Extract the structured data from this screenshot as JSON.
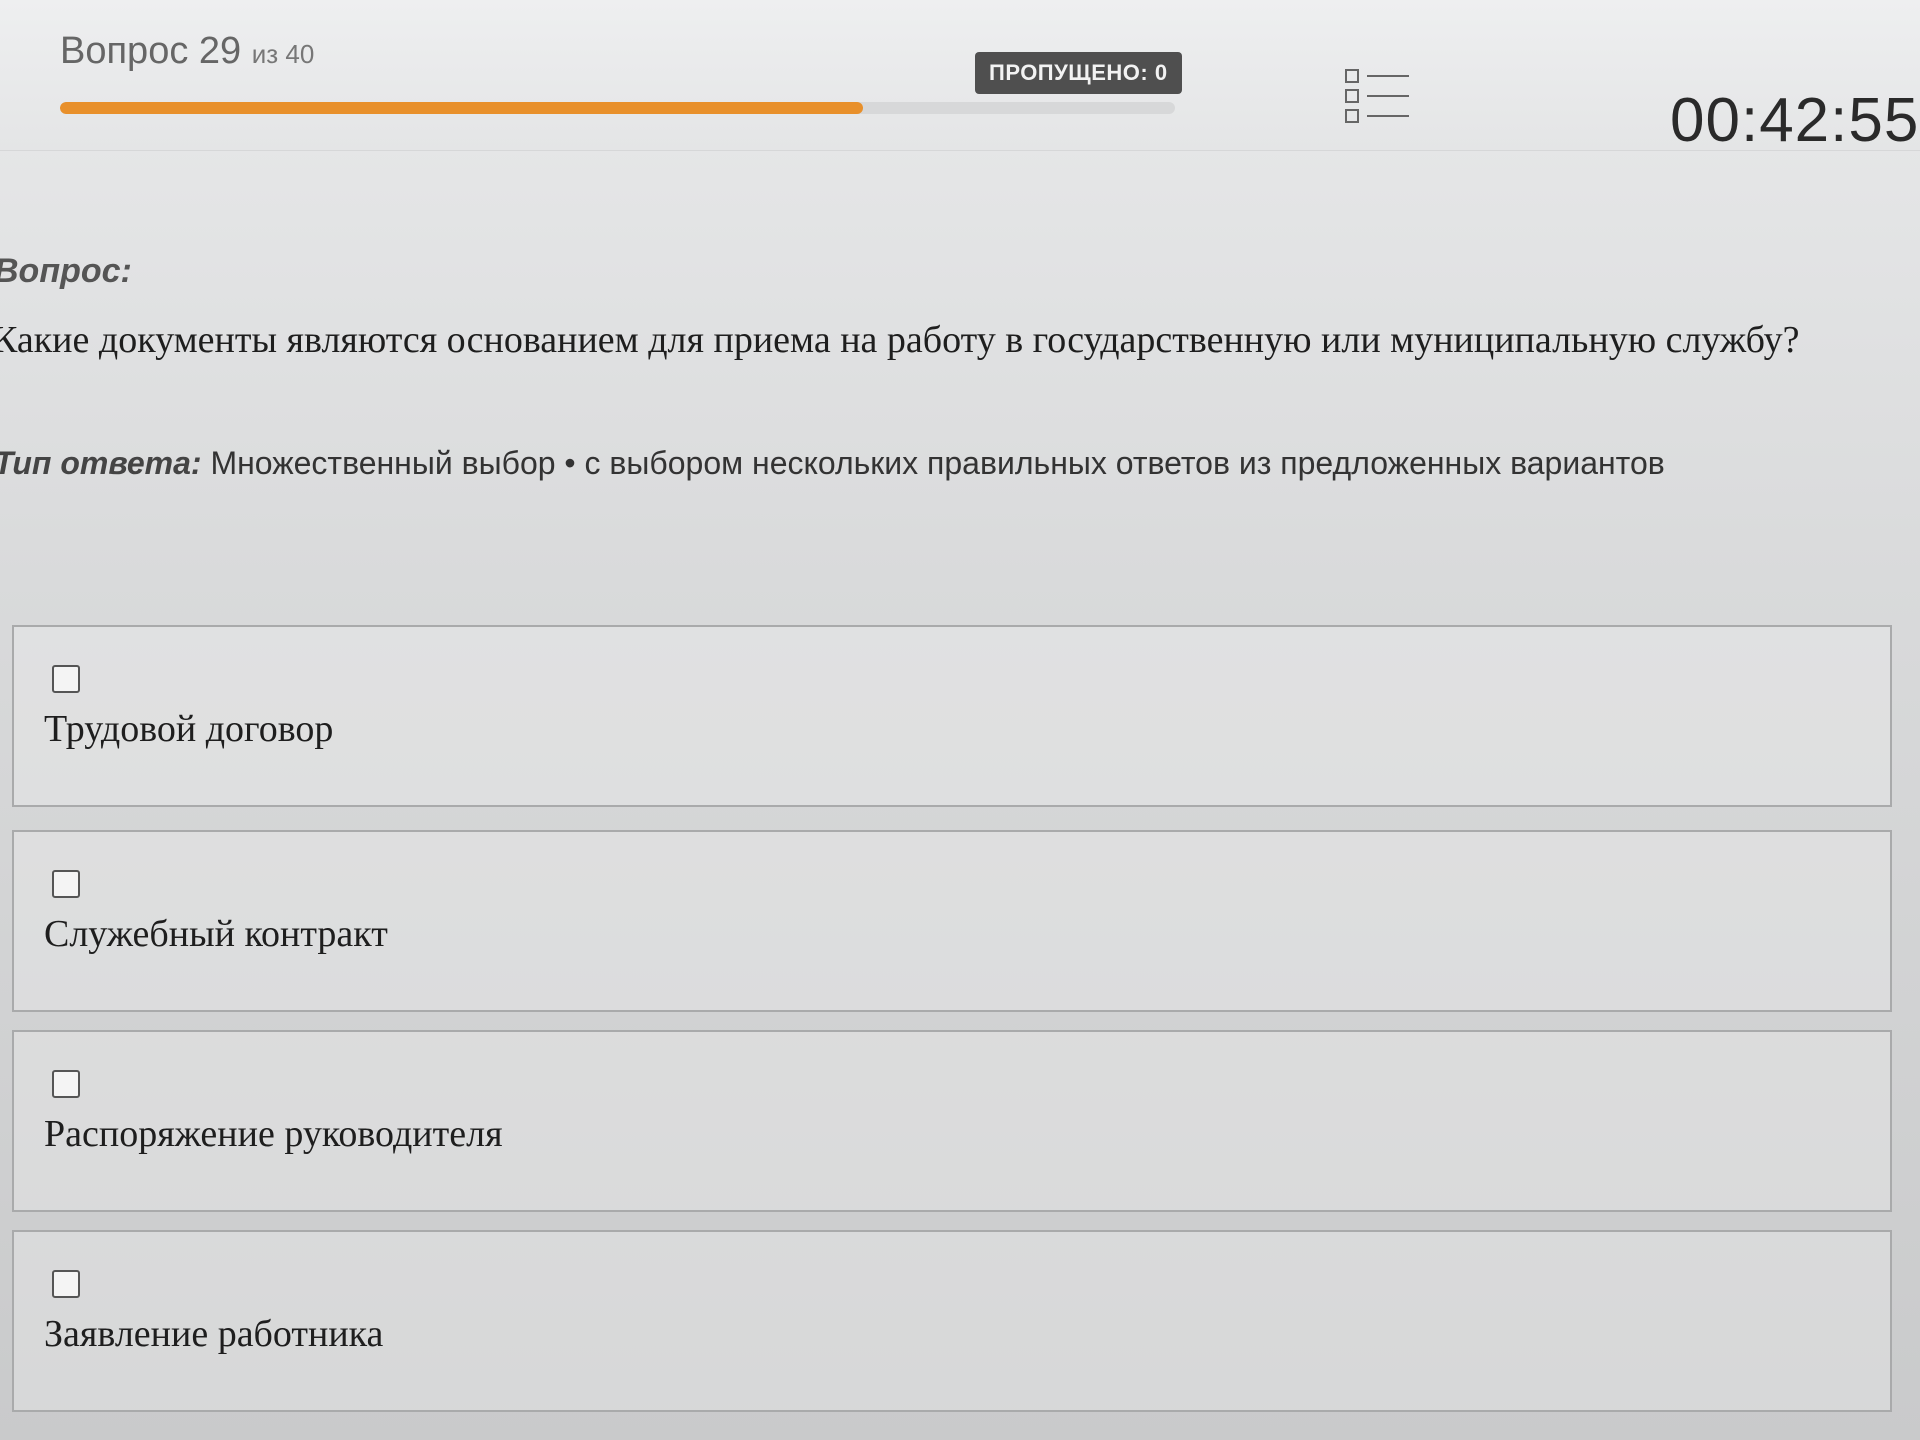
{
  "header": {
    "question_number": "Вопрос 29",
    "question_total": "из 40",
    "progress": 0.72,
    "skipped_badge": "ПРОПУЩЕНО: 0",
    "list_icon": "list-icon",
    "timer": "00:42:55",
    "accent_color": "#e8902b"
  },
  "question": {
    "label": "Вопрос:",
    "text": "Какие документы являются основанием для приема на работу в государственную или муниципальную службу?"
  },
  "answer_type": {
    "label": "Тип ответа:",
    "value": "Множественный выбор • с выбором нескольких правильных ответов из предложенных вариантов"
  },
  "options": [
    {
      "label": "Трудовой договор",
      "checked": false
    },
    {
      "label": "Служебный контракт",
      "checked": false
    },
    {
      "label": "Распоряжение руководителя",
      "checked": false
    },
    {
      "label": "Заявление работника",
      "checked": false
    }
  ]
}
